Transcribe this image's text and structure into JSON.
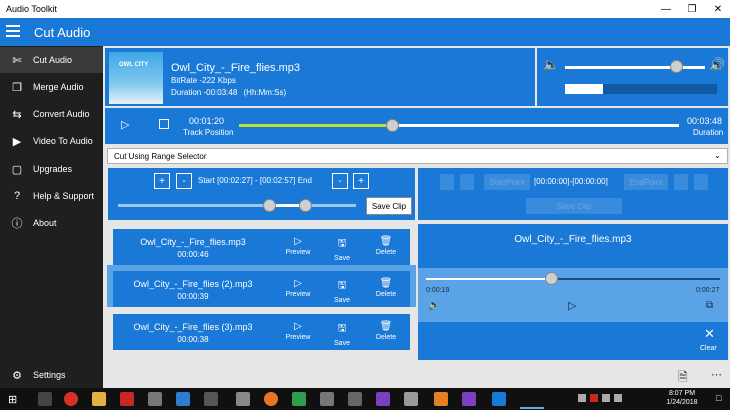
{
  "window": {
    "title": "Audio Toolkit",
    "min_icon": "minimize-icon",
    "max_icon": "maximize-icon",
    "close_icon": "close-icon"
  },
  "header": {
    "title": "Cut Audio"
  },
  "sidebar": {
    "items": [
      {
        "icon": "scissors-icon",
        "label": "Cut Audio",
        "active": true
      },
      {
        "icon": "merge-icon",
        "label": "Merge Audio"
      },
      {
        "icon": "convert-icon",
        "label": "Convert Audio"
      },
      {
        "icon": "video-icon",
        "label": "Video To Audio"
      },
      {
        "icon": "bag-icon",
        "label": "Upgrades"
      },
      {
        "icon": "question-icon",
        "label": "Help & Support"
      },
      {
        "icon": "info-icon",
        "label": "About"
      }
    ],
    "settings_label": "Settings"
  },
  "track": {
    "album_text": "OWL CITY",
    "filename": "Owl_City_-_Fire_flies.mp3",
    "bitrate": "BitRate -222 Kbps",
    "duration": "Duration -00:03:48",
    "duration_unit": "(Hh:Mm:Ss)"
  },
  "volume": {
    "level": 0.8,
    "bar_level": 0.25
  },
  "playback": {
    "position": "00:01:20",
    "position_label": "Track Position",
    "total": "00:03:48",
    "total_label": "Duration",
    "progress": 0.35
  },
  "mode_select": {
    "value": "Cut Using Range Selector"
  },
  "range": {
    "start_label": "Start",
    "start": "[00:02:27]",
    "separator": "-",
    "end": "[00:02:57]",
    "end_label": "End",
    "save_clip": "Save Clip",
    "plus": "+",
    "minus": "-",
    "range_low": 0.64,
    "range_high": 0.79
  },
  "points": {
    "start_point": "StartPoint",
    "range": "[00:00:00]-[00:00:00]",
    "end_point": "EndPoint",
    "save_clip": "Save Clip"
  },
  "clips": [
    {
      "name": "Owl_City_-_Fire_flies.mp3",
      "duration": "00:00:46"
    },
    {
      "name": "Owl_City_-_Fire_flies (2).mp3",
      "duration": "00:00:39"
    },
    {
      "name": "Owl_City_-_Fire_flies (3).mp3",
      "duration": "00:00:38"
    }
  ],
  "clip_actions": {
    "preview": "Preview",
    "save": "Save",
    "delete": "Delete"
  },
  "player": {
    "filename": "Owl_City_-_Fire_flies.mp3",
    "elapsed": "0:00:19",
    "total": "0:00:27",
    "progress": 0.43,
    "clear_label": "Clear"
  },
  "taskbar": {
    "time": "8:07 PM",
    "date": "1/24/2018"
  },
  "colors": {
    "accent": "#1a78d6",
    "sidebar": "#1f1f1f",
    "selected_card": "#5aa3e6"
  }
}
